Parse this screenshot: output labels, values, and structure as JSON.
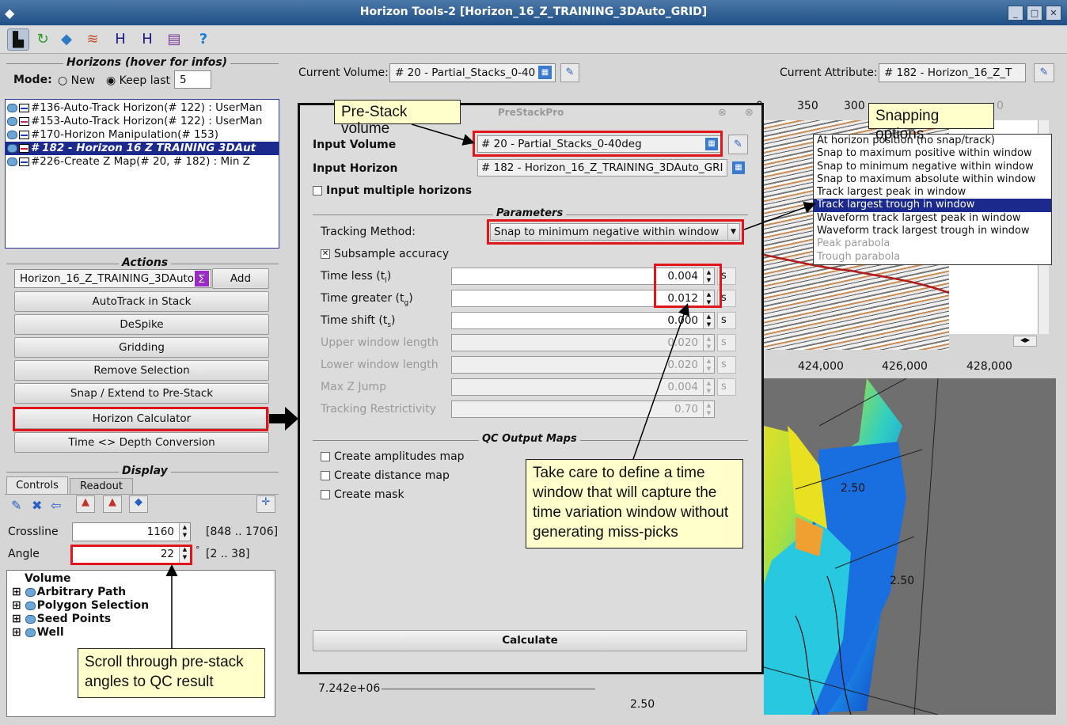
{
  "window": {
    "title": "Horizon Tools-2 [Horizon_16_Z_TRAINING_3DAuto_GRID]",
    "buttons": [
      "_",
      "□",
      "✕"
    ]
  },
  "horizons": {
    "title": "Horizons (hover for infos)",
    "mode_label": "Mode:",
    "mode_new": "New",
    "mode_keep": "Keep last",
    "keep_value": "5",
    "items": [
      {
        "label": "#136-Auto-Track Horizon(# 122) : UserMan",
        "color": "#1a3fbf",
        "selected": false
      },
      {
        "label": "#153-Auto-Track Horizon(# 122) : UserMan",
        "color": "#c0237a",
        "selected": false
      },
      {
        "label": "#170-Horizon Manipulation(# 153)",
        "color": "#1a3fbf",
        "selected": false
      },
      {
        "label": "# 182 - Horizon 16 Z TRAINING 3DAut",
        "color": "#d01a1a",
        "selected": true
      },
      {
        "label": "#226-Create Z Map(# 20, # 182) : Min Z",
        "color": "#1a3fbf",
        "selected": false
      }
    ]
  },
  "actions": {
    "title": "Actions",
    "horizon_field": "Horizon_16_Z_TRAINING_3DAuto",
    "add": "Add",
    "buttons": [
      "AutoTrack in Stack",
      "DeSpike",
      "Gridding",
      "Remove Selection",
      "Snap / Extend to Pre-Stack",
      "Horizon Calculator",
      "Time <> Depth Conversion"
    ]
  },
  "display": {
    "title": "Display",
    "tabs": [
      "Controls",
      "Readout"
    ],
    "crossline_label": "Crossline",
    "crossline_value": "1160",
    "crossline_range": "[848 .. 1706]",
    "angle_label": "Angle",
    "angle_value": "22",
    "angle_unit": "°",
    "angle_range": "[2 .. 38]",
    "tree": [
      "Volume",
      "Arbitrary Path",
      "Polygon Selection",
      "Seed Points",
      "Well"
    ]
  },
  "header": {
    "current_volume_label": "Current Volume:",
    "current_volume": "# 20 - Partial_Stacks_0-40",
    "current_attribute_label": "Current Attribute:",
    "current_attribute": "# 182 - Horizon_16_Z_T"
  },
  "dialog": {
    "title": "PreStackPro",
    "input_volume_label": "Input Volume",
    "input_volume": "# 20 - Partial_Stacks_0-40deg",
    "input_horizon_label": "Input Horizon",
    "input_horizon": "# 182 - Horizon_16_Z_TRAINING_3DAuto_GRI",
    "multiple_horizons": "Input multiple horizons",
    "parameters_title": "Parameters",
    "tracking_method_label": "Tracking Method:",
    "tracking_method": "Snap to minimum negative within window",
    "subsample": "Subsample accuracy",
    "params": [
      {
        "label": "Time less (t",
        "sub": "l",
        "value": "0.004",
        "unit": "s",
        "enabled": true
      },
      {
        "label": "Time greater (t",
        "sub": "g",
        "value": "0.012",
        "unit": "s",
        "enabled": true
      },
      {
        "label": "Time shift (t",
        "sub": "s",
        "value": "0.000",
        "unit": "s",
        "enabled": true
      },
      {
        "label": "Upper window length",
        "sub": "",
        "value": "0.020",
        "unit": "s",
        "enabled": false
      },
      {
        "label": "Lower window length",
        "sub": "",
        "value": "0.020",
        "unit": "s",
        "enabled": false
      },
      {
        "label": "Max Z Jump",
        "sub": "",
        "value": "0.004",
        "unit": "s",
        "enabled": false
      },
      {
        "label": "Tracking Restrictivity",
        "sub": "",
        "value": "0.70",
        "unit": "",
        "enabled": false
      }
    ],
    "qc_title": "QC Output Maps",
    "qc_items": [
      "Create amplitudes map",
      "Create distance map",
      "Create mask"
    ],
    "calculate": "Calculate"
  },
  "snap_options": [
    {
      "label": "At horizon position (no snap/track)",
      "state": "normal"
    },
    {
      "label": "Snap to maximum positive within window",
      "state": "normal"
    },
    {
      "label": "Snap to minimum negative within window",
      "state": "normal"
    },
    {
      "label": "Snap to maximum absolute within window",
      "state": "normal"
    },
    {
      "label": "Track largest peak in window",
      "state": "normal"
    },
    {
      "label": "Track largest trough in window",
      "state": "selected"
    },
    {
      "label": "Waveform track largest peak in window",
      "state": "normal"
    },
    {
      "label": "Waveform track largest trough in window",
      "state": "normal"
    },
    {
      "label": "Peak parabola",
      "state": "disabled"
    },
    {
      "label": "Trough parabola",
      "state": "disabled"
    }
  ],
  "axis": {
    "top_ticks": [
      "0",
      "350",
      "300",
      "0"
    ],
    "bottom_ticks": [
      "424,000",
      "426,000",
      "428,000"
    ],
    "y_tick": "7.242e+06",
    "contours": [
      "2.50",
      "2.50",
      "2.50"
    ]
  },
  "callouts": {
    "prestack": "Pre-Stack volume",
    "snapping": "Snapping options",
    "window": "Take care to define a time window that will capture the time variation window without generating miss-picks",
    "scroll": "Scroll through pre-stack angles to QC result"
  }
}
